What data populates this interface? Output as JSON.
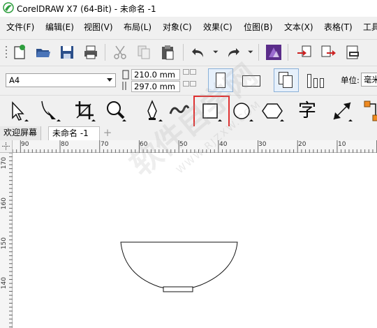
{
  "window": {
    "title": "CorelDRAW X7 (64-Bit) - 未命名 -1"
  },
  "menu": [
    "文件(F)",
    "编辑(E)",
    "视图(V)",
    "布局(L)",
    "对象(C)",
    "效果(C)",
    "位图(B)",
    "文本(X)",
    "表格(T)",
    "工具"
  ],
  "property_bar": {
    "paper_size": "A4",
    "width": "210.0 mm",
    "height": "297.0 mm",
    "units_label": "单位:",
    "units_value": "毫米"
  },
  "toolbox": {
    "text_tool_glyph": "字"
  },
  "tabs": {
    "welcome": "欢迎屏幕",
    "document": "未命名 -1",
    "add": "+"
  },
  "ruler": {
    "horizontal": [
      "90",
      "80",
      "70",
      "60",
      "50",
      "40",
      "30",
      "20",
      "10"
    ],
    "vertical": [
      "170",
      "160",
      "150",
      "140"
    ]
  },
  "watermark": {
    "main": "软件自学网",
    "sub": "WWW.RJZXW.COM"
  },
  "colors": {
    "highlight": "#e03030",
    "accent_purple": "#5b2d8a",
    "logo_green": "#2e9e3e"
  }
}
